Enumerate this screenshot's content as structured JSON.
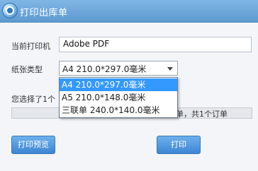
{
  "window": {
    "title": "打印出库单"
  },
  "form": {
    "printer_label": "当前打印机",
    "printer_value": "Adobe PDF",
    "paper_label": "纸张类型",
    "paper_selected": "A4  210.0*297.0毫米",
    "paper_options": [
      "A4  210.0*297.0毫米",
      "A5  210.0*148.0毫米",
      "三联单 240.0*140.0毫米"
    ]
  },
  "status": {
    "selected_text_visible": "您选择了1个",
    "progress_text_visible": "单，共1个订单"
  },
  "buttons": {
    "preview": "打印预览",
    "print": "打印"
  }
}
